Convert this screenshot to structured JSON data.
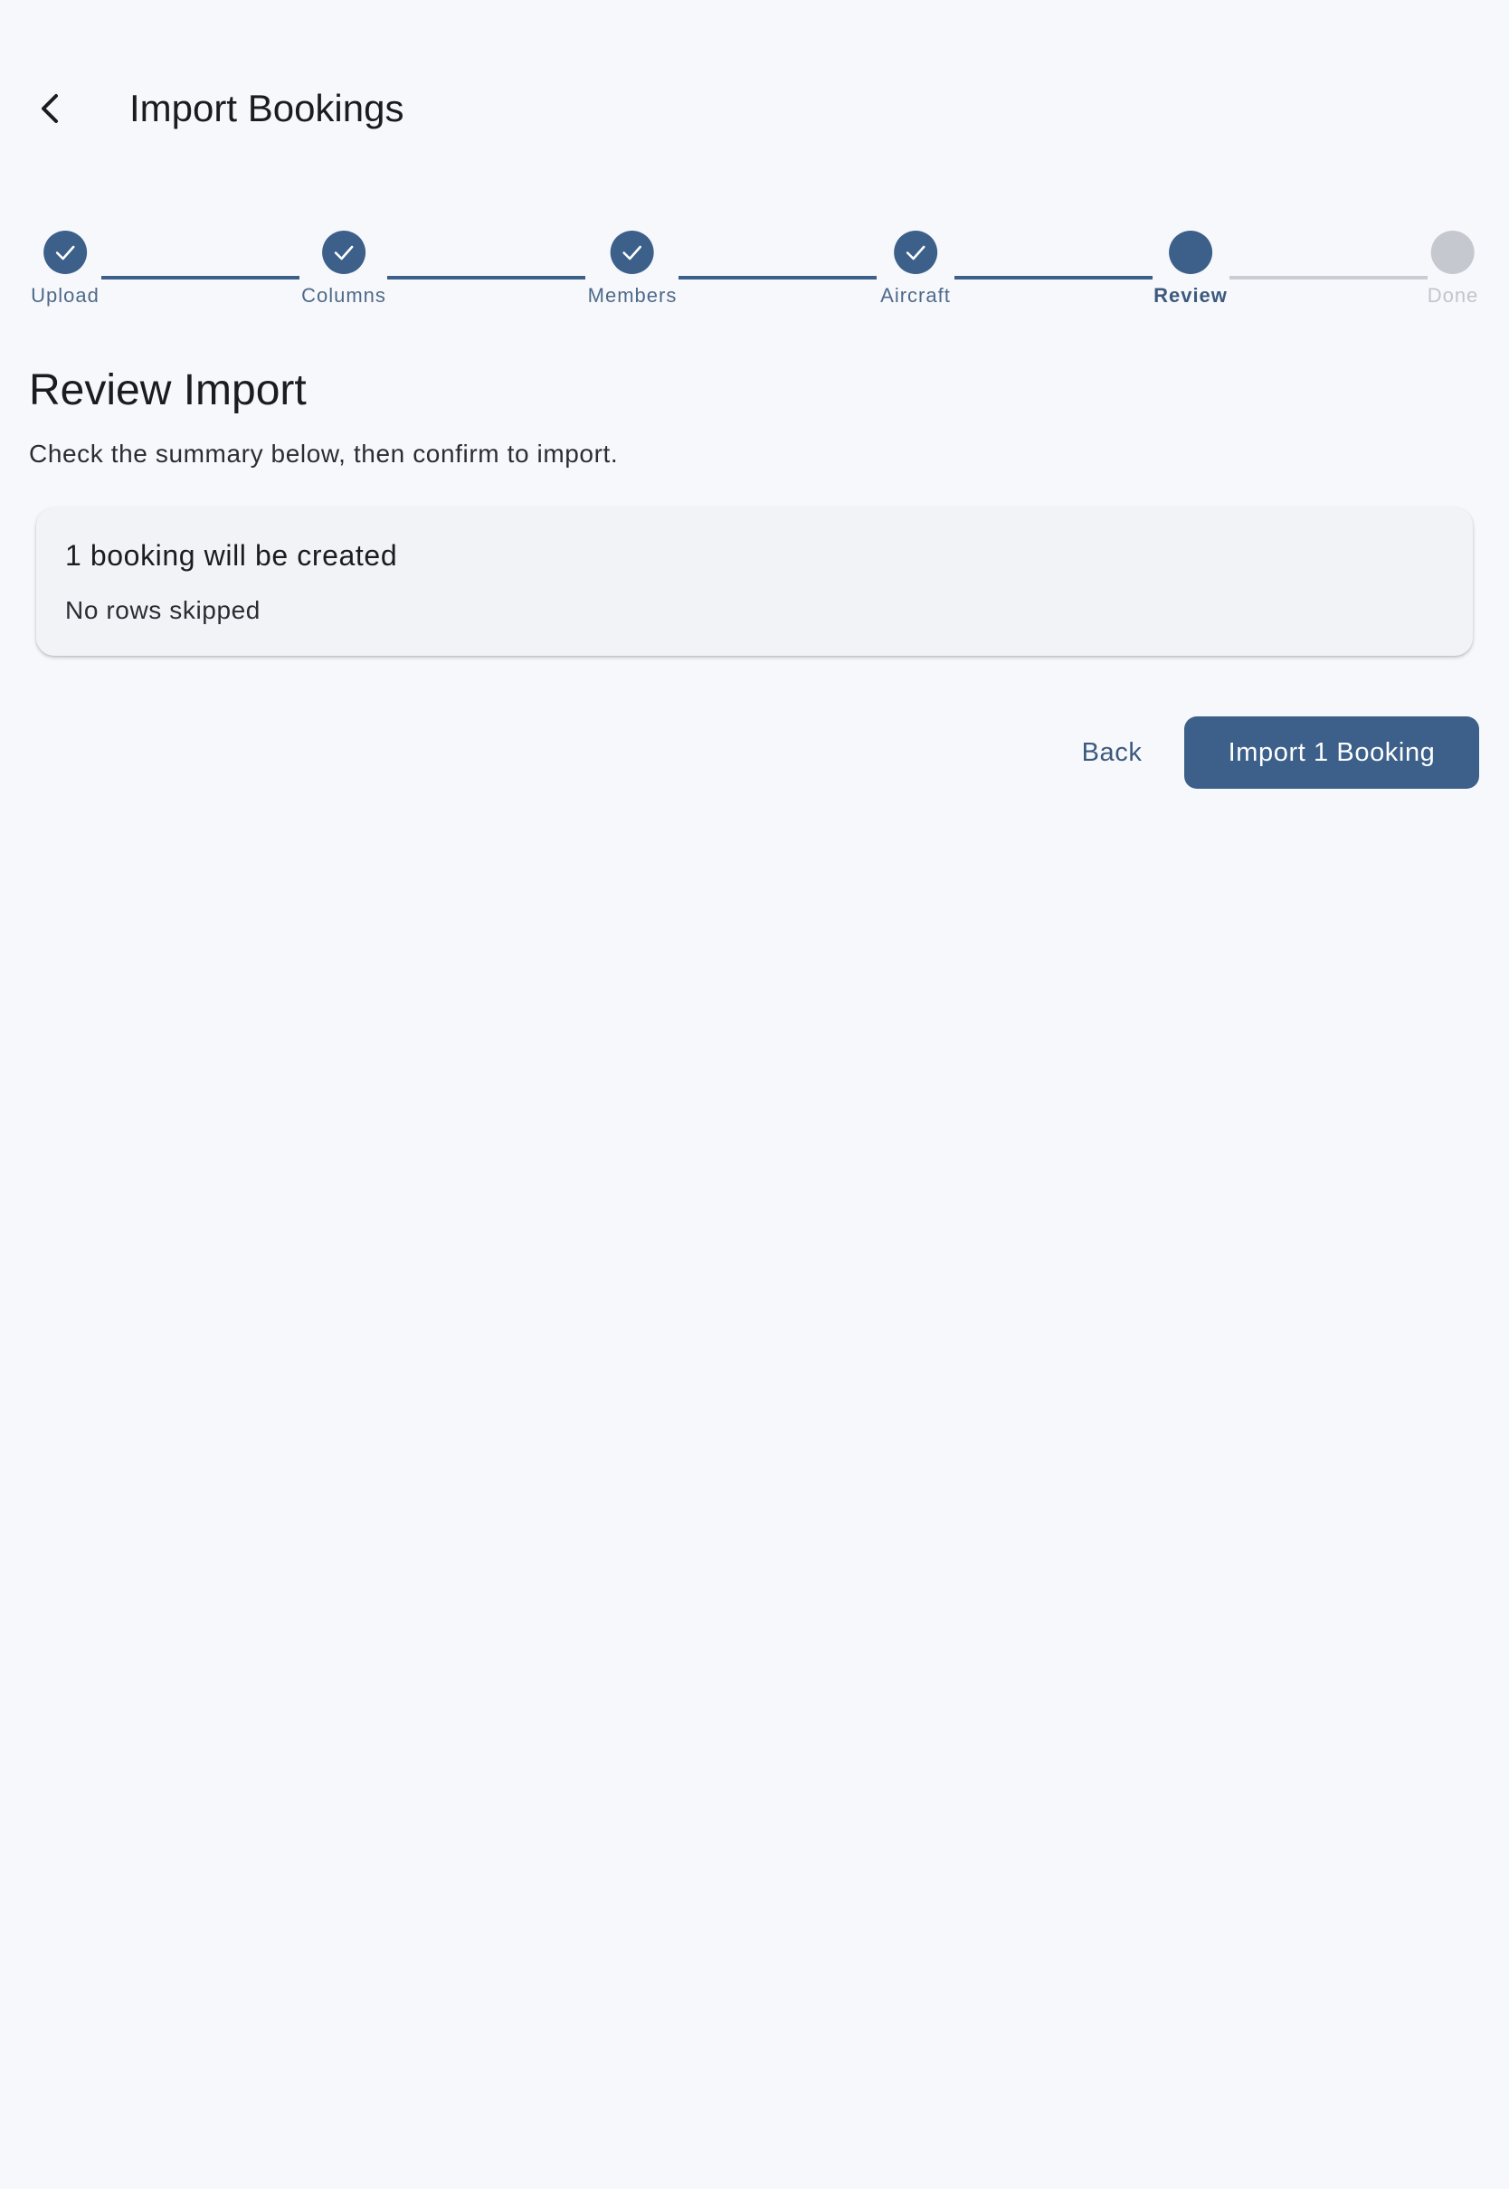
{
  "header": {
    "back_icon": "chevron-left-icon",
    "title": "Import Bookings"
  },
  "stepper": {
    "steps": [
      {
        "label": "Upload",
        "status": "complete",
        "icon": "check-icon"
      },
      {
        "label": "Columns",
        "status": "complete",
        "icon": "check-icon"
      },
      {
        "label": "Members",
        "status": "complete",
        "icon": "check-icon"
      },
      {
        "label": "Aircraft",
        "status": "complete",
        "icon": "check-icon"
      },
      {
        "label": "Review",
        "status": "active"
      },
      {
        "label": "Done",
        "status": "pending"
      }
    ]
  },
  "main": {
    "title": "Review Import",
    "subtitle": "Check the summary below, then confirm to import.",
    "summary": {
      "heading": "1 booking will be created",
      "detail": "No rows skipped"
    }
  },
  "actions": {
    "back_label": "Back",
    "import_label": "Import 1 Booking"
  },
  "colors": {
    "background": "#f7f8fc",
    "primary": "#3c6089",
    "pending": "#c5c8cf",
    "card": "#f2f3f7"
  }
}
